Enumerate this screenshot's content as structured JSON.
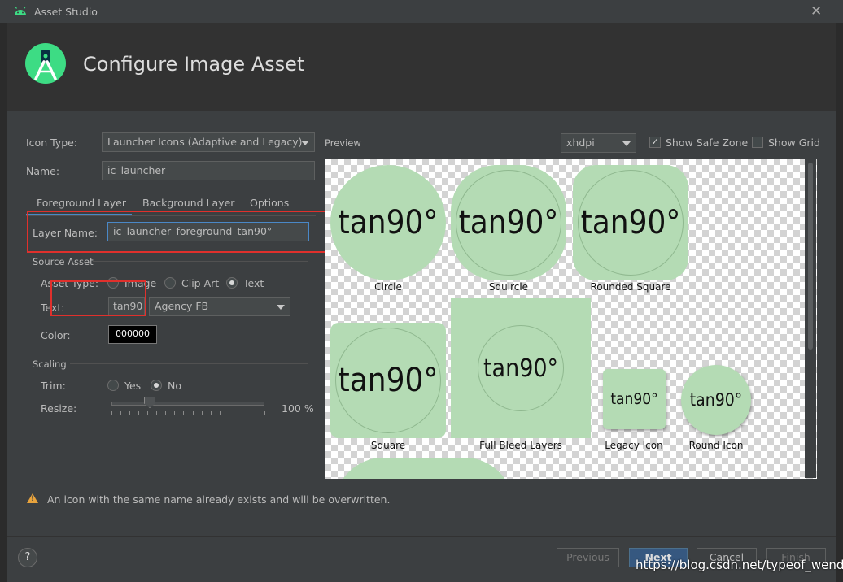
{
  "window": {
    "title": "Asset Studio",
    "close_glyph": "✕"
  },
  "header": {
    "title": "Configure Image Asset",
    "logo_icon": "android-studio-logo-icon"
  },
  "form": {
    "icon_type_label": "Icon Type:",
    "icon_type_value": "Launcher Icons (Adaptive and Legacy)",
    "name_label": "Name:",
    "name_value": "ic_launcher",
    "tabs": [
      "Foreground Layer",
      "Background Layer",
      "Options"
    ],
    "layer_name_label": "Layer Name:",
    "layer_name_value": "ic_launcher_foreground_tan90°",
    "source_asset_label": "Source Asset",
    "asset_type_label": "Asset Type:",
    "asset_type_options": [
      "Image",
      "Clip Art",
      "Text"
    ],
    "asset_type_selected": "Text",
    "text_label": "Text:",
    "text_value": "tan90",
    "font_value": "Agency FB",
    "color_label": "Color:",
    "color_value": "000000",
    "scaling_label": "Scaling",
    "trim_label": "Trim:",
    "trim_options": [
      "Yes",
      "No"
    ],
    "trim_selected": "No",
    "resize_label": "Resize:",
    "resize_value": "100 %",
    "resize_percent": 100
  },
  "preview": {
    "label": "Preview",
    "density_value": "xhdpi",
    "show_safe_zone_label": "Show Safe Zone",
    "show_safe_zone_checked": true,
    "show_grid_label": "Show Grid",
    "show_grid_checked": false,
    "icon_text": "tan90°",
    "icon_color": "#b4dbb4",
    "icons": [
      "Circle",
      "Squircle",
      "Rounded Square",
      "Square",
      "Full Bleed Layers",
      "Legacy Icon",
      "Round Icon"
    ]
  },
  "warning": {
    "text": "An icon with the same name already exists and will be overwritten.",
    "icon": "warning-icon"
  },
  "buttons": {
    "help": "?",
    "previous": "Previous",
    "next": "Next",
    "cancel": "Cancel",
    "finish": "Finish"
  },
  "watermark": "https://blog.csdn.net/typeof_wendu",
  "colors": {
    "accent": "#4a88c7",
    "highlight": "#e0302c",
    "primary_button": "#365880"
  }
}
